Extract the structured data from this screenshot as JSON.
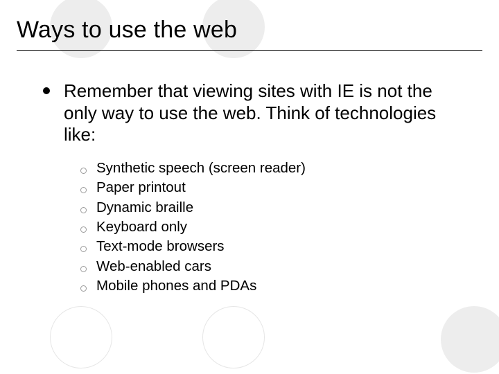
{
  "title": "Ways to use the web",
  "intro": "Remember that viewing sites with IE is not the only way to use the web. Think of technologies like:",
  "subitems": [
    "Synthetic speech (screen reader)",
    "Paper printout",
    "Dynamic braille",
    "Keyboard only",
    "Text-mode browsers",
    "Web-enabled cars",
    "Mobile phones and PDAs"
  ]
}
